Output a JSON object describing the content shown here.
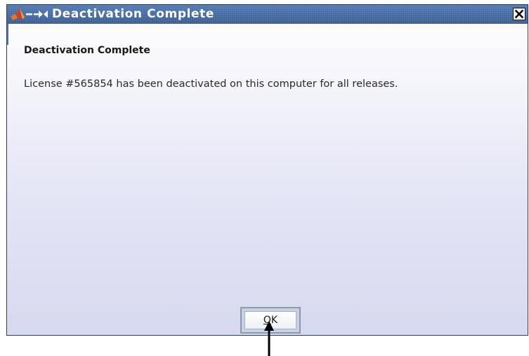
{
  "window": {
    "title": "Deactivation Complete",
    "icons": {
      "app": "matlab-logo-icon",
      "minimize": "minimize-icon",
      "maximize": "maximize-icon",
      "close": "close-icon"
    },
    "colors": {
      "titlebar": "#3a5f97",
      "title_text": "#ffffff",
      "background_top": "#ffffff",
      "background_bottom": "#d7d9ef"
    }
  },
  "content": {
    "heading": "Deactivation Complete",
    "message": "License #565854 has been deactivated on this computer for all releases."
  },
  "buttons": {
    "ok": {
      "mnemonic": "O",
      "rest": "K"
    }
  }
}
